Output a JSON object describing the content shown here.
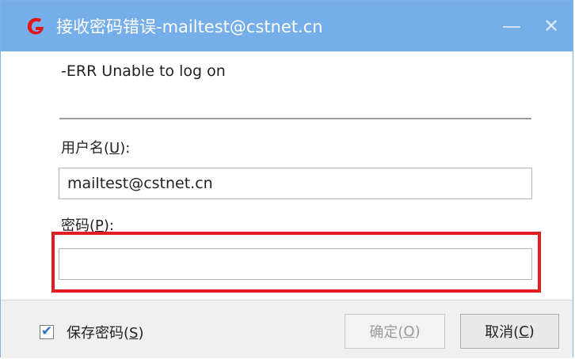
{
  "window": {
    "title": "接收密码错误-mailtest@cstnet.cn",
    "minimize_glyph": "—",
    "close_glyph": "✕",
    "accent_color": "#75aee8",
    "icon": "foxmail-logo-icon"
  },
  "message": "-ERR Unable to log on",
  "username": {
    "label_prefix": "用户名(",
    "label_hotkey": "U",
    "label_suffix": "):",
    "value": "mailtest@cstnet.cn"
  },
  "password": {
    "label_prefix": "密码(",
    "label_hotkey": "P",
    "label_suffix": "):",
    "value": ""
  },
  "footer": {
    "save_checked": true,
    "save_label_prefix": "保存密码(",
    "save_label_hotkey": "S",
    "save_label_suffix": ")",
    "ok_prefix": "确定(",
    "ok_hotkey": "O",
    "ok_suffix": ")",
    "cancel_prefix": "取消(",
    "cancel_hotkey": "C",
    "cancel_suffix": ")"
  },
  "highlight_color": "#e21d1f"
}
